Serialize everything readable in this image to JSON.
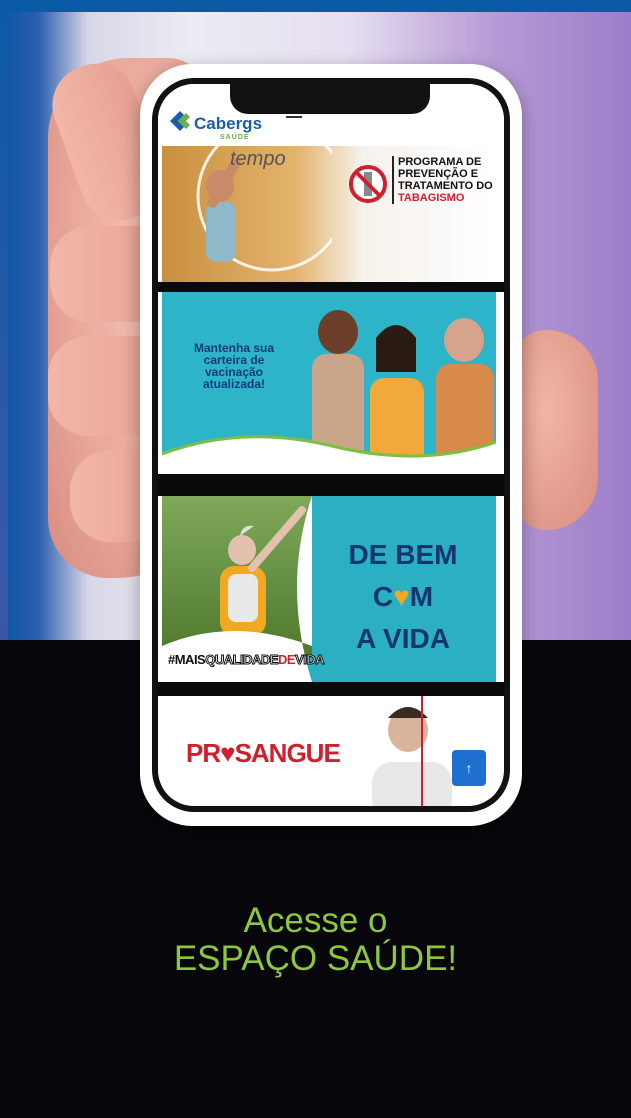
{
  "header": {
    "logo_text": "Cabergs",
    "logo_sub": "SAÚDE"
  },
  "banners": {
    "tabagismo": {
      "word": "tempo",
      "title_line1": "PROGRAMA DE",
      "title_line2": "PREVENÇÃO E",
      "title_line3": "TRATAMENTO DO",
      "title_line4": "TABAGISMO"
    },
    "vacina": {
      "line1": "Mantenha sua",
      "line2": "carteira de",
      "line3": "vacinação",
      "line4": "atualizada!"
    },
    "bem_vida": {
      "line1": "DE BEM",
      "line2_pre": "C",
      "line2_post": "M",
      "line3": "A VIDA",
      "hashtag_pre": "#MAIS",
      "hashtag_mid": "QUALIDADE",
      "hashtag_de": "DE",
      "hashtag_post": "VIDA"
    },
    "sangue": {
      "pre": "PR",
      "post": "SANGUE"
    }
  },
  "back_to_top_icon": "arrow-up-icon",
  "cta": {
    "line1": "Acesse o",
    "line2": "ESPAÇO SAÚDE!"
  },
  "colors": {
    "cta": "#8dc63f",
    "teal": "#2db4c9",
    "brand_blue": "#1b5eab",
    "red": "#d0202e"
  }
}
